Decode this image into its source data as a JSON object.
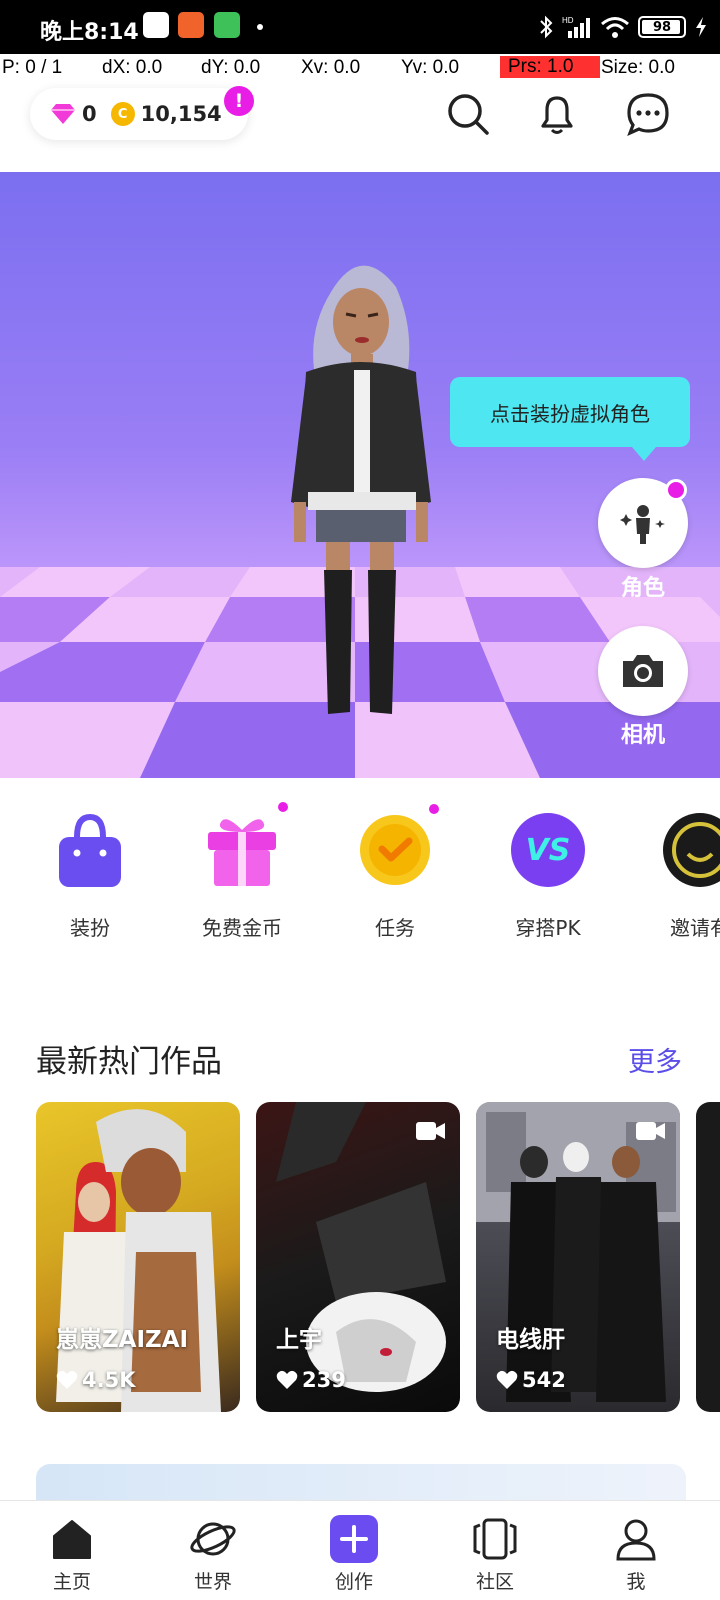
{
  "status_bar": {
    "time": "晚上8:14",
    "battery": "98",
    "icons": [
      "bluetooth-icon",
      "hd-signal-icon",
      "wifi-icon",
      "battery-icon",
      "charging-icon"
    ]
  },
  "debug": {
    "p": "P: 0 / 1",
    "dx": "dX: 0.0",
    "dy": "dY: 0.0",
    "xv": "Xv: 0.0",
    "yv": "Yv: 0.0",
    "prs": "Prs: 1.0",
    "size": "Size: 0.0"
  },
  "wallet": {
    "diamonds": "0",
    "coins": "10,154",
    "coin_symbol": "C",
    "alert": "!"
  },
  "hero": {
    "tooltip": "点击装扮虚拟角色",
    "character_label": "角色",
    "camera_label": "相机"
  },
  "actions": [
    {
      "label": "装扮",
      "icon": "bag-icon"
    },
    {
      "label": "免费金币",
      "icon": "gift-icon"
    },
    {
      "label": "任务",
      "icon": "check-badge-icon"
    },
    {
      "label": "穿搭PK",
      "icon": "vs-icon"
    },
    {
      "label": "邀请有",
      "icon": "invite-icon"
    }
  ],
  "hot_section": {
    "title": "最新热门作品",
    "more": "更多",
    "cards": [
      {
        "name": "崽崽ZAIZAI",
        "likes": "4.5K",
        "video": false
      },
      {
        "name": "上宇",
        "likes": "239",
        "video": true
      },
      {
        "name": "电线肝",
        "likes": "542",
        "video": true
      }
    ]
  },
  "bottom_nav": [
    {
      "label": "主页",
      "icon": "home-icon"
    },
    {
      "label": "世界",
      "icon": "planet-icon"
    },
    {
      "label": "创作",
      "icon": "plus-icon"
    },
    {
      "label": "社区",
      "icon": "cards-icon"
    },
    {
      "label": "我",
      "icon": "profile-icon"
    }
  ],
  "colors": {
    "accent": "#6b4cf0",
    "badge": "#e91ee6",
    "tooltip": "#4ee6f0",
    "coin": "#f5b700"
  }
}
